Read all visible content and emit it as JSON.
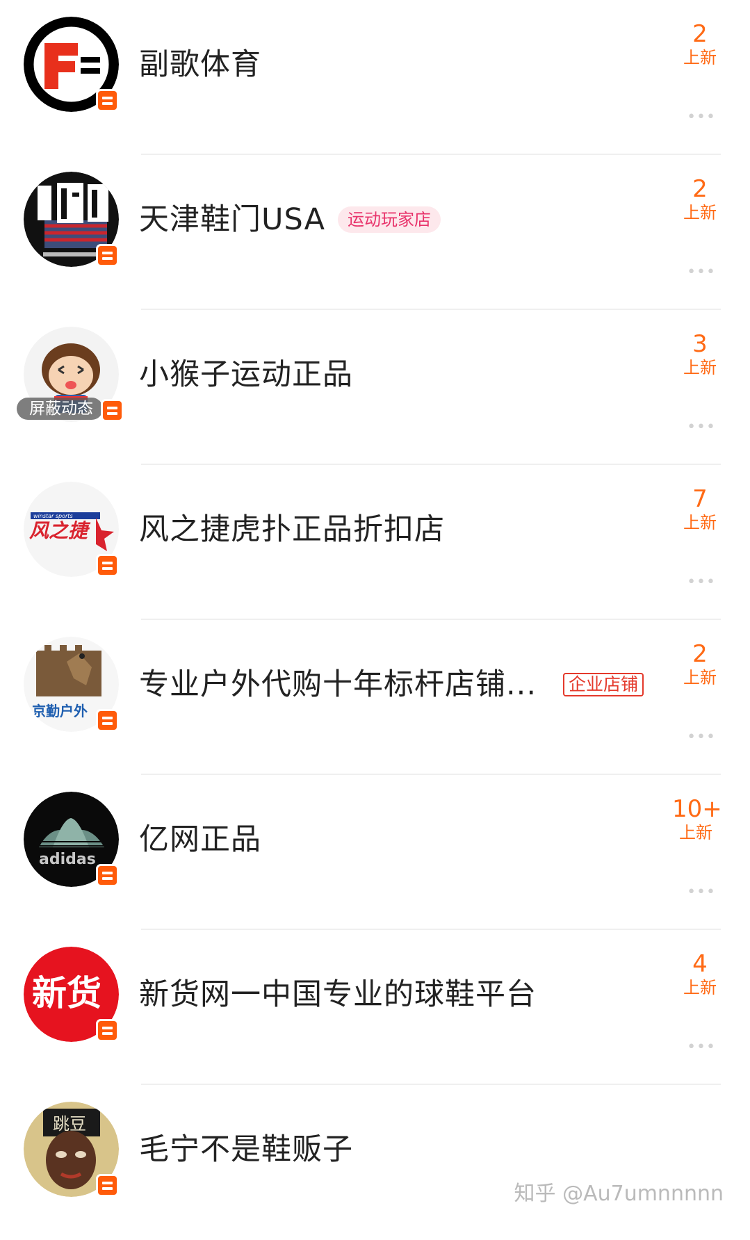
{
  "accent_color": "#ff6a15",
  "stores": [
    {
      "name": "副歌体育",
      "count": "2",
      "count_label": "上新",
      "avatar_icon": "fuge-f-logo-icon"
    },
    {
      "name": "天津鞋门USA",
      "tag": "运动玩家店",
      "count": "2",
      "count_label": "上新",
      "avatar_icon": "tianjin-shoe-gate-logo-icon"
    },
    {
      "name": "小猴子运动正品",
      "muted_label": "屏蔽动态",
      "count": "3",
      "count_label": "上新",
      "avatar_icon": "monkey-cartoon-icon"
    },
    {
      "name": "风之捷虎扑正品折扣店",
      "count": "7",
      "count_label": "上新",
      "avatar_icon": "winstar-sports-logo-icon",
      "avatar_text_top": "winstar sports",
      "avatar_text_main": "风之捷"
    },
    {
      "name": "专业户外代购十年标杆店铺...",
      "enterprise_tag": "企业店铺",
      "count": "2",
      "count_label": "上新",
      "avatar_icon": "great-wall-logo-icon",
      "avatar_text": "京勤户外"
    },
    {
      "name": "亿网正品",
      "count": "10+",
      "count_label": "上新",
      "avatar_icon": "adidas-trefoil-icon",
      "avatar_text": "adidas"
    },
    {
      "name": "新货网一中国专业的球鞋平台",
      "count": "4",
      "count_label": "上新",
      "avatar_icon": "xinhuo-logo-icon",
      "avatar_text": "新货"
    },
    {
      "name": "毛宁不是鞋贩子",
      "avatar_icon": "tiaodou-portrait-icon",
      "avatar_text": "跳豆"
    }
  ],
  "more_glyph": "•••",
  "watermark": "知乎 @Au7umnnnnn"
}
